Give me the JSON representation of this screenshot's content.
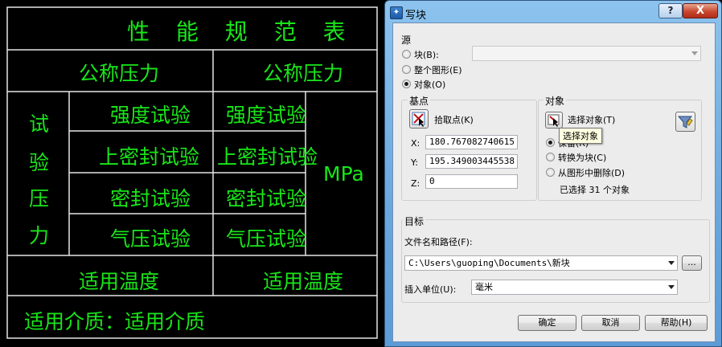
{
  "cad": {
    "title": "性 能 规 范 表",
    "row_nominal": {
      "label": "公称压力",
      "value": "公称压力"
    },
    "test_pressure_label": [
      "试",
      "验",
      "压",
      "力"
    ],
    "tests": [
      {
        "label": "强度试验",
        "value": "强度试验"
      },
      {
        "label": "上密封试验",
        "value": "上密封试验"
      },
      {
        "label": "密封试验",
        "value": "密封试验"
      },
      {
        "label": "气压试验",
        "value": "气压试验"
      }
    ],
    "unit": "MPa",
    "row_temp": {
      "label": "适用温度",
      "value": "适用温度"
    },
    "medium": "适用介质：适用介质",
    "line_color": "#e6e6e6",
    "text_color": "#19e619"
  },
  "dialog": {
    "title": "写块",
    "help_btn": "?",
    "close_btn": "X",
    "source": {
      "label": "源",
      "options": [
        {
          "label": "块(B):",
          "selected": false
        },
        {
          "label": "整个图形(E)",
          "selected": false
        },
        {
          "label": "对象(O)",
          "selected": true
        }
      ],
      "block_combo_value": ""
    },
    "base_point": {
      "label": "基点",
      "pick_label": "拾取点(K)",
      "x_label": "X:",
      "x_value": "180.767082740615",
      "y_label": "Y:",
      "y_value": "195.349003445538",
      "z_label": "Z:",
      "z_value": "0"
    },
    "objects": {
      "label": "对象",
      "select_label": "选择对象(T)",
      "tooltip": "选择对象",
      "options": [
        {
          "label": "保留(R)",
          "selected": true
        },
        {
          "label": "转换为块(C)",
          "selected": false
        },
        {
          "label": "从图形中删除(D)",
          "selected": false
        }
      ],
      "selected_count": "已选择 31 个对象"
    },
    "target": {
      "label": "目标",
      "path_label": "文件名和路径(F):",
      "path_value": "C:\\Users\\guoping\\Documents\\新块",
      "browse_label": "...",
      "units_label": "插入单位(U):",
      "units_value": "毫米"
    },
    "buttons": {
      "ok": "确定",
      "cancel": "取消",
      "help": "帮助(H)"
    }
  }
}
